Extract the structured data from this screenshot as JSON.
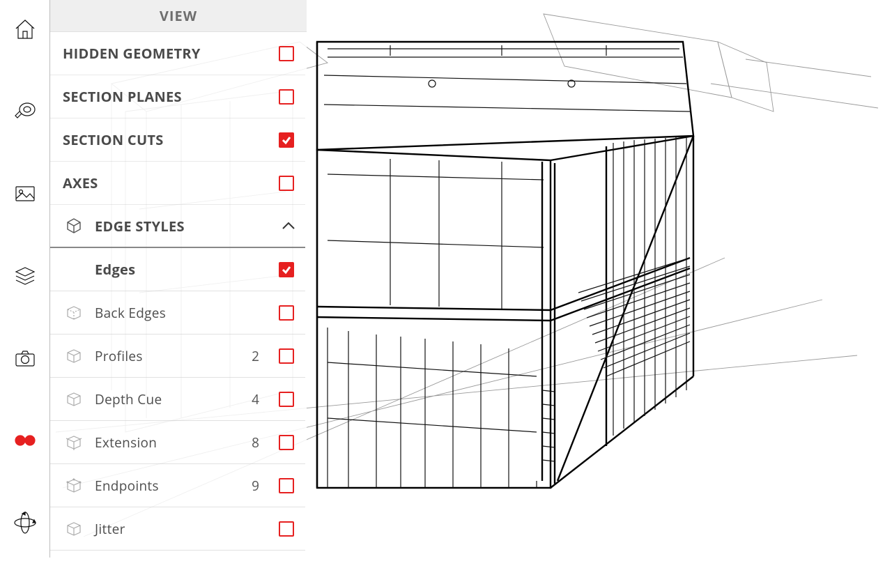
{
  "panel": {
    "title": "VIEW",
    "items": [
      {
        "label": "HIDDEN GEOMETRY",
        "checked": false
      },
      {
        "label": "SECTION PLANES",
        "checked": false
      },
      {
        "label": "SECTION CUTS",
        "checked": true
      },
      {
        "label": "AXES",
        "checked": false
      }
    ],
    "group": {
      "label": "EDGE STYLES",
      "expanded": true
    },
    "edge_styles": [
      {
        "label": "Edges",
        "checked": true,
        "value": ""
      },
      {
        "label": "Back Edges",
        "checked": false,
        "value": ""
      },
      {
        "label": "Profiles",
        "checked": false,
        "value": "2"
      },
      {
        "label": "Depth Cue",
        "checked": false,
        "value": "4"
      },
      {
        "label": "Extension",
        "checked": false,
        "value": "8"
      },
      {
        "label": "Endpoints",
        "checked": false,
        "value": "9"
      },
      {
        "label": "Jitter",
        "checked": false,
        "value": ""
      }
    ]
  },
  "rail": {
    "items": [
      "home",
      "tape-measure",
      "image",
      "layers",
      "camera",
      "view-goggles",
      "orbit"
    ],
    "active": "view-goggles"
  },
  "colors": {
    "accent": "#e62020"
  }
}
